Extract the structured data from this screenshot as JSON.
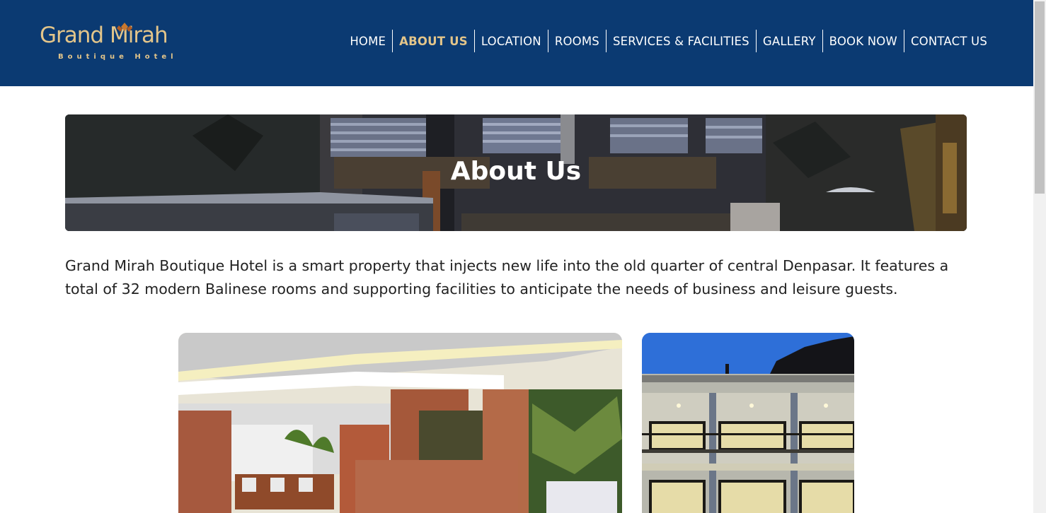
{
  "brand": {
    "name_left": "Grand ",
    "name_right": "Mirah",
    "subtitle": "Boutique Hotel",
    "primary_color": "#0b3a72",
    "accent_color": "#e3c58a"
  },
  "nav": {
    "items": [
      {
        "label": "HOME",
        "active": false
      },
      {
        "label": "ABOUT US",
        "active": true
      },
      {
        "label": "LOCATION",
        "active": false
      },
      {
        "label": "ROOMS",
        "active": false
      },
      {
        "label": "SERVICES & FACILITIES",
        "active": false
      },
      {
        "label": "GALLERY",
        "active": false
      },
      {
        "label": "BOOK NOW",
        "active": false
      },
      {
        "label": "CONTACT US",
        "active": false
      }
    ]
  },
  "hero": {
    "title": "About Us"
  },
  "intro": {
    "text": "Grand Mirah Boutique Hotel is a smart property that injects new life into the old quarter of central Denpasar. It features a total of 32 modern Balinese rooms and supporting facilities to anticipate the needs of business and leisure guests."
  },
  "icons": {
    "logo_mark": "lotus-icon"
  }
}
